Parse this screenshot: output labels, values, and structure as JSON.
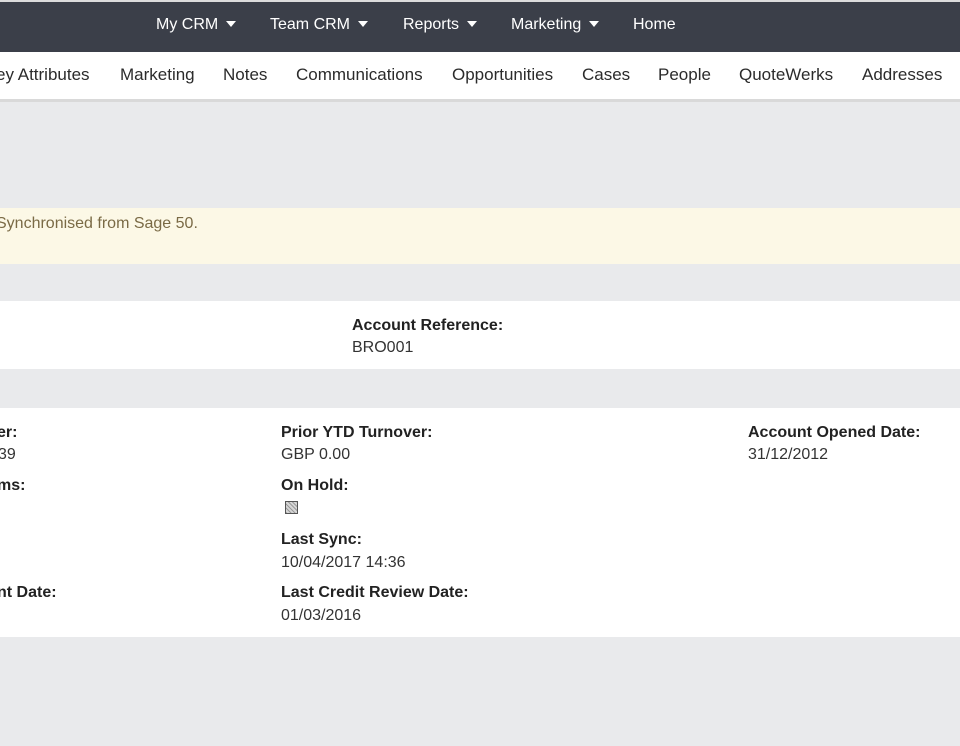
{
  "topnav": {
    "items": [
      {
        "label": "My CRM",
        "dropdown": true
      },
      {
        "label": "Team CRM",
        "dropdown": true
      },
      {
        "label": "Reports",
        "dropdown": true
      },
      {
        "label": "Marketing",
        "dropdown": true
      },
      {
        "label": "Home",
        "dropdown": false
      }
    ]
  },
  "tabs": [
    {
      "label": "ey Attributes"
    },
    {
      "label": "Marketing"
    },
    {
      "label": "Notes"
    },
    {
      "label": "Communications"
    },
    {
      "label": "Opportunities"
    },
    {
      "label": "Cases"
    },
    {
      "label": "People"
    },
    {
      "label": "QuoteWerks"
    },
    {
      "label": "Addresses"
    }
  ],
  "notice": {
    "text": "Synchronised from Sage 50."
  },
  "account": {
    "reference_label": "Account Reference:",
    "reference_value": "BRO001"
  },
  "details": {
    "col1": [
      {
        "label": "er:",
        "value": "39"
      },
      {
        "label": "ms:",
        "value": ""
      },
      {
        "label": "nt Date:",
        "value": ""
      }
    ],
    "prior_ytd_label": "Prior YTD Turnover:",
    "prior_ytd_value": "GBP 0.00",
    "on_hold_label": "On Hold:",
    "on_hold_checked": false,
    "last_sync_label": "Last Sync:",
    "last_sync_value": "10/04/2017 14:36",
    "last_credit_label": "Last Credit Review Date:",
    "last_credit_value": "01/03/2016",
    "opened_label": "Account Opened Date:",
    "opened_value": "31/12/2012"
  },
  "colors": {
    "topbar": "#3b3f49",
    "notice_bg": "#fcf8e6",
    "notice_text": "#7a6a45",
    "page_bg": "#e9eaec"
  }
}
